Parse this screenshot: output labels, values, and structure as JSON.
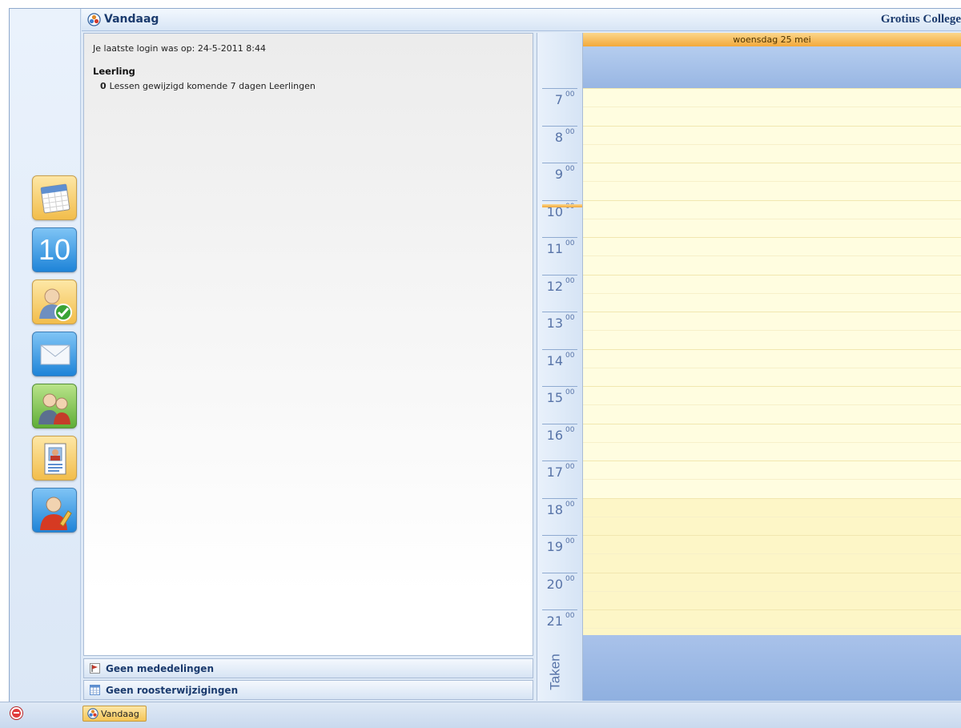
{
  "title_bar": {
    "title": "Vandaag",
    "school": "Grotius College"
  },
  "main": {
    "last_login": "Je laatste login was op: 24-5-2011 8:44",
    "section_title": "Leerling",
    "section_row": {
      "count": "0",
      "text": "Lessen gewijzigd komende 7 dagen Leerlingen"
    }
  },
  "strips": {
    "announcements": "Geen mededelingen",
    "schedule_changes": "Geen roosterwijzigingen"
  },
  "sidebar": {
    "items": [
      {
        "name": "agenda",
        "icon": "calendar-icon"
      },
      {
        "name": "rooster",
        "icon": "day-number-icon",
        "label": "10"
      },
      {
        "name": "aanwezigheid",
        "icon": "person-check-icon"
      },
      {
        "name": "berichten",
        "icon": "mail-icon"
      },
      {
        "name": "leerlingen",
        "icon": "people-icon"
      },
      {
        "name": "persoonsgegevens",
        "icon": "id-card-icon"
      },
      {
        "name": "instellingen",
        "icon": "person-edit-icon"
      }
    ]
  },
  "calendar": {
    "day_header": "woensdag 25 mei",
    "hours": [
      "7",
      "8",
      "9",
      "10",
      "11",
      "12",
      "13",
      "14",
      "15",
      "16",
      "17",
      "18",
      "19",
      "20",
      "21"
    ],
    "minute_label": "00",
    "tasks_label": "Taken",
    "current_time": "10:00"
  },
  "taskbar": {
    "button_label": "Vandaag",
    "power_icon": "power-icon"
  },
  "colors": {
    "accent": "#f3a93b",
    "title_text": "#1b3b6e",
    "grid_bg": "#fffde0",
    "allday_bg": "#98b6e3"
  }
}
